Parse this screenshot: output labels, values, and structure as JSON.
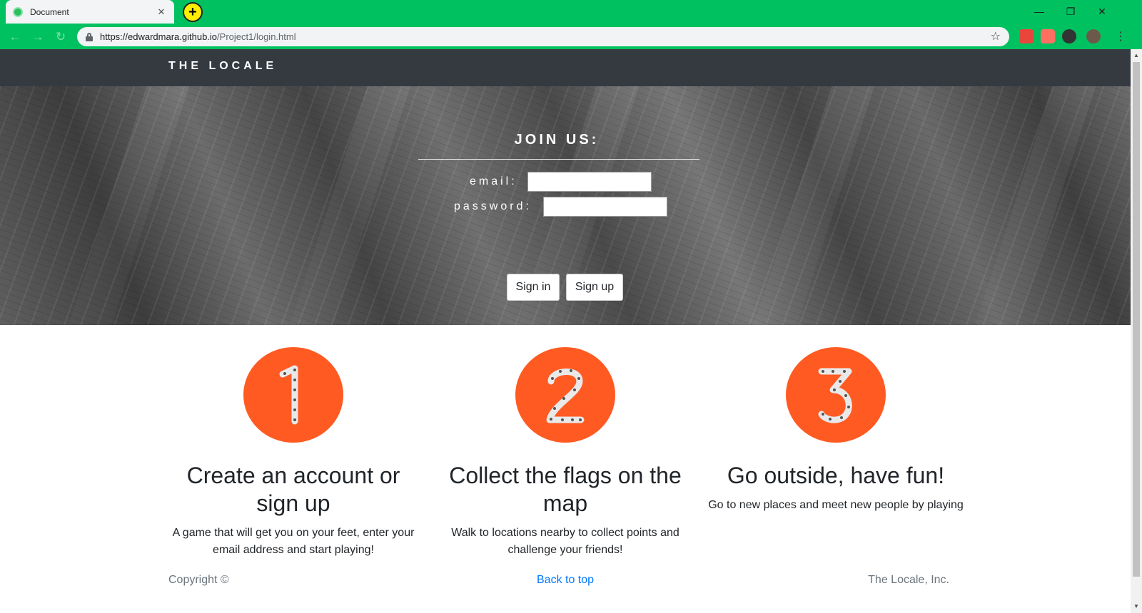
{
  "browser": {
    "tab_title": "Document",
    "tab_close": "✕",
    "new_tab": "+",
    "minimize": "—",
    "restore": "❐",
    "close": "✕",
    "back": "←",
    "forward": "→",
    "reload": "↻",
    "url_host": "https://edwardmara.github.io",
    "url_path": "/Project1/login.html",
    "bookmark": "☆",
    "menu": "⋮"
  },
  "navbar": {
    "brand": "THE LOCALE"
  },
  "hero": {
    "title": "JOIN US:",
    "email_label": "email:",
    "password_label": "password:",
    "email_value": "",
    "password_value": "",
    "signin_label": "Sign in",
    "signup_label": "Sign up"
  },
  "features": [
    {
      "number": "1",
      "title": "Create an account or sign up",
      "text": "A game that will get you on your feet, enter your email address and start playing!"
    },
    {
      "number": "2",
      "title": "Collect the flags on the map",
      "text": "Walk to locations nearby to collect points and challenge your friends!"
    },
    {
      "number": "3",
      "title": "Go outside, have fun!",
      "text": "Go to new places and meet new people by playing"
    }
  ],
  "footer": {
    "copyright": "Copyright ©",
    "back_to_top": "Back to top",
    "company": "The Locale, Inc."
  },
  "colors": {
    "chrome": "#00c160",
    "navbar": "#343a40",
    "feature_circle": "#ff5a22",
    "link": "#007bff"
  }
}
